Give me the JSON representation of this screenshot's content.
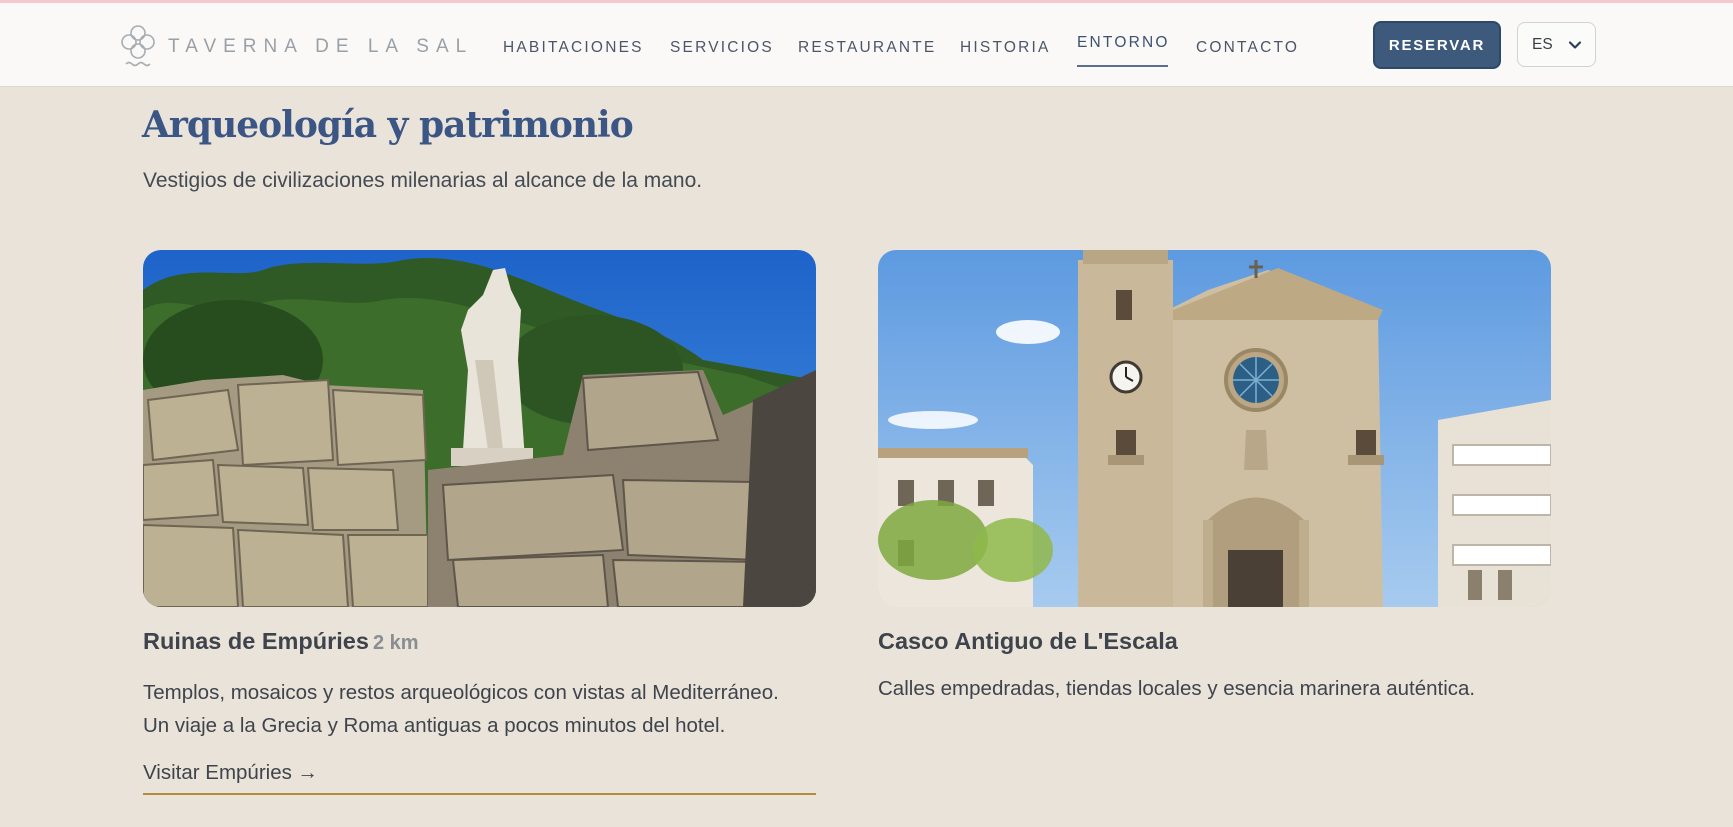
{
  "brand": {
    "name": "TAVERNA DE LA SAL"
  },
  "nav": {
    "items": [
      {
        "label": "HABITACIONES",
        "active": false
      },
      {
        "label": "SERVICIOS",
        "active": false
      },
      {
        "label": "RESTAURANTE",
        "active": false
      },
      {
        "label": "HISTORIA",
        "active": false
      },
      {
        "label": "ENTORNO",
        "active": true
      },
      {
        "label": "CONTACTO",
        "active": false
      }
    ],
    "cta_label": "RESERVAR",
    "language": "ES"
  },
  "section": {
    "title": "Arqueología y patrimonio",
    "subtitle": "Vestigios de civilizaciones milenarias al alcance de la mano."
  },
  "cards": [
    {
      "title": "Ruinas de Empúries",
      "distance": "2 km",
      "desc_line1": "Templos, mosaicos y restos arqueológicos con vistas al Mediterráneo.",
      "desc_line2": "Un viaje a la Grecia y Roma antiguas a pocos minutos del hotel.",
      "link": "Visitar Empúries →"
    },
    {
      "title": "Casco Antiguo de L'Escala",
      "desc_line1": "Calles empedradas, tiendas locales y esencia marinera auténtica."
    }
  ],
  "colors": {
    "background": "#e9e3da",
    "header_bg": "#faf9f7",
    "accent_blue": "#3d5a7c",
    "title_blue": "#3b5685",
    "link_underline": "#b58a3a"
  },
  "icons": {
    "logo": "clover-knot-icon",
    "language_chevron": "chevron-down-icon"
  }
}
